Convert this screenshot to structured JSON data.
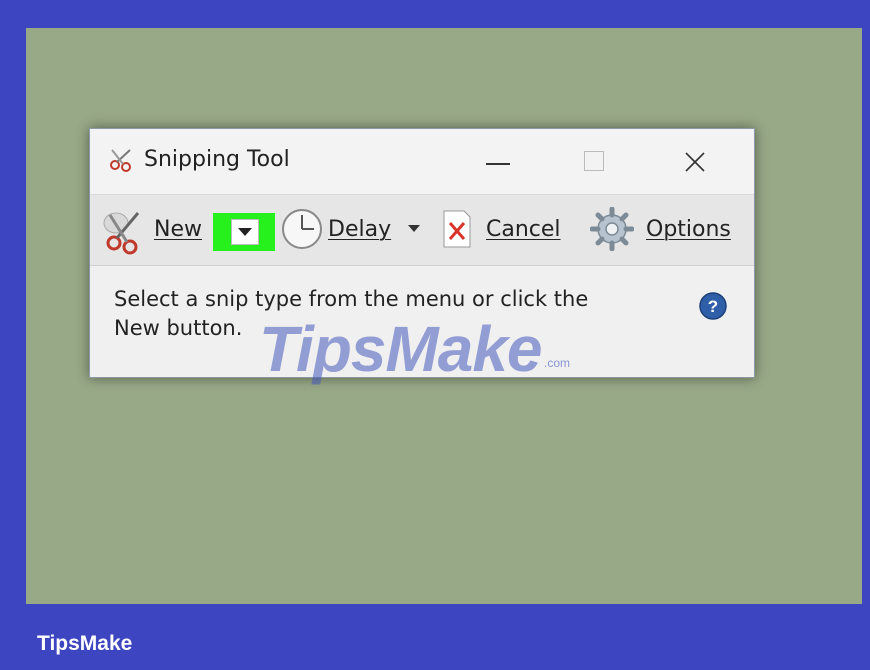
{
  "window": {
    "title": "Snipping Tool",
    "title_icon": "scissors-icon",
    "controls": [
      "minimize-icon",
      "maximize-icon",
      "close-icon"
    ]
  },
  "toolbar": {
    "new_label": "New",
    "new_icon": "scissors-icon",
    "new_dropdown_icon": "chevron-down-icon",
    "delay_label": "Delay",
    "delay_icon": "clock-icon",
    "delay_dropdown_icon": "chevron-down-icon",
    "cancel_label": "Cancel",
    "cancel_icon": "cancel-icon",
    "options_label": "Options",
    "options_icon": "gear-icon"
  },
  "status": {
    "line1": "Select a snip type from the menu or click the",
    "line2": "New button.",
    "help_icon": "help-icon"
  },
  "watermark": {
    "text": "TipsMake",
    "suffix": ".com"
  },
  "footer": {
    "brand": "TipsMake"
  },
  "colors": {
    "outer_frame": "#3d45c1",
    "background": "#98a987",
    "highlight": "#26f11c"
  }
}
